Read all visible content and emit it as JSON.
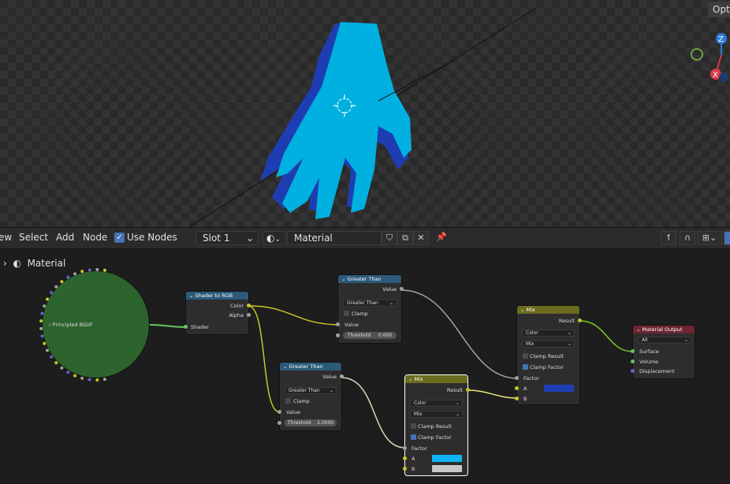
{
  "viewport": {
    "options_tab": "Opti",
    "gizmo": {
      "z": "Z",
      "x": "X"
    },
    "colors": {
      "hand_front": "#00b0e0",
      "hand_back": "#1f3db3",
      "gizmo_z": "#2f7bd6",
      "gizmo_x": "#d63a4a",
      "gizmo_y": "#6aa34a"
    }
  },
  "header": {
    "menus": [
      "ew",
      "Select",
      "Add",
      "Node"
    ],
    "use_nodes_label": "Use Nodes",
    "slot": "Slot 1",
    "material_name": "Material"
  },
  "editor": {
    "breadcrumb": "Material",
    "principled": {
      "label": "Principled BSDF"
    },
    "shader_to_rgb": {
      "title": "Shader to RGB",
      "out_color": "Color",
      "out_alpha": "Alpha",
      "in_shader": "Shader"
    },
    "greater1": {
      "title": "Greater Than",
      "out_value": "Value",
      "operation": "Greater Than",
      "clamp": "Clamp",
      "in_value": "Value",
      "threshold_label": "Threshold",
      "threshold_value": "0.600"
    },
    "greater2": {
      "title": "Greater Than",
      "out_value": "Value",
      "operation": "Greater Than",
      "clamp": "Clamp",
      "in_value": "Value",
      "threshold_label": "Threshold",
      "threshold_value": "2.0000"
    },
    "mix1": {
      "title": "Mix",
      "out_result": "Result",
      "data_type": "Color",
      "blend": "Mix",
      "clamp_result": "Clamp Result",
      "clamp_factor": "Clamp Factor",
      "factor": "Factor",
      "a": "A",
      "b": "B",
      "a_color": "#1f3db3"
    },
    "mix2": {
      "title": "Mix",
      "out_result": "Result",
      "data_type": "Color",
      "blend": "Mix",
      "clamp_result": "Clamp Result",
      "clamp_factor": "Clamp Factor",
      "factor": "Factor",
      "a": "A",
      "b": "B",
      "a_color": "#10b4f4",
      "b_color": "#c8c8c8"
    },
    "output": {
      "title": "Material Output",
      "target": "All",
      "surface": "Surface",
      "volume": "Volume",
      "displacement": "Displacement"
    }
  }
}
